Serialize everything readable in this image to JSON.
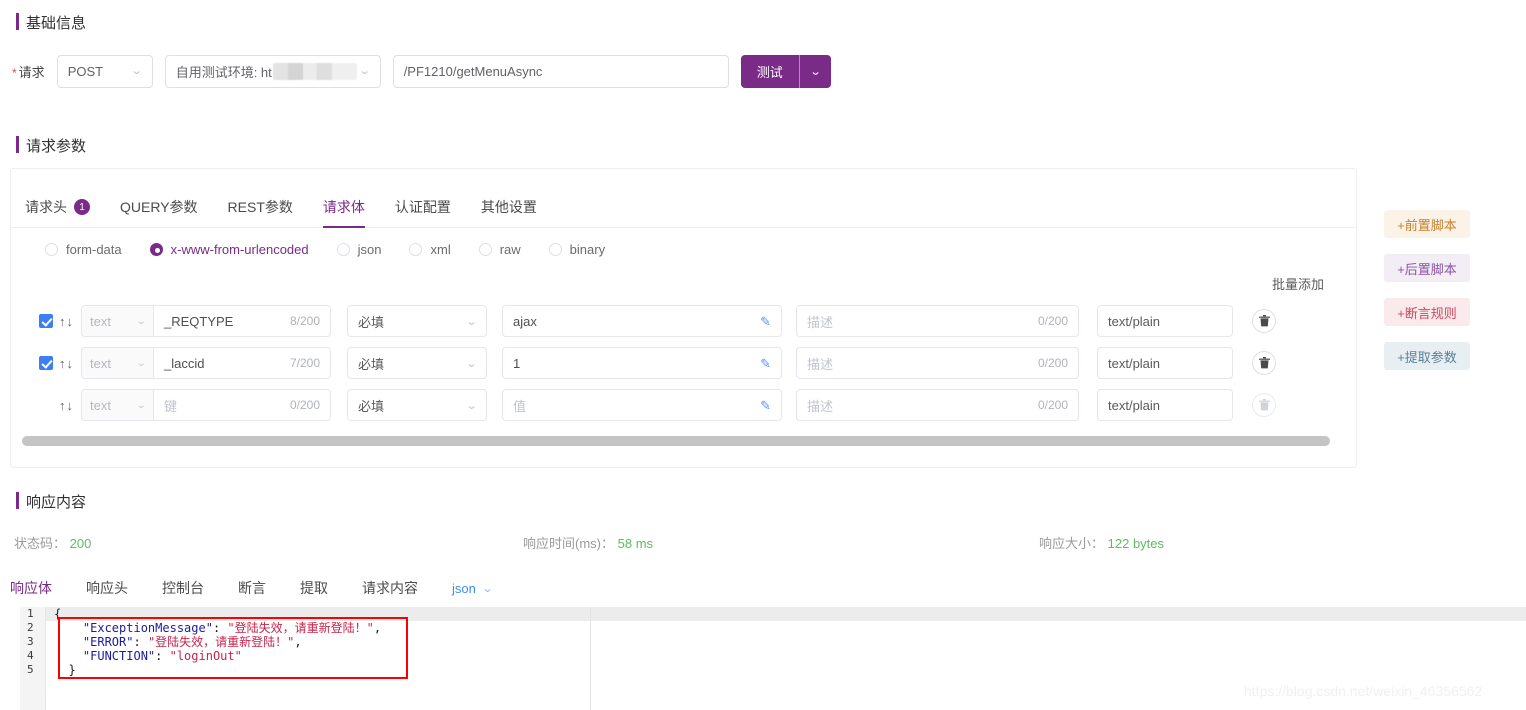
{
  "basic": {
    "section_title": "基础信息",
    "request_label": "请求",
    "required_star": "*",
    "method": "POST",
    "environment": "自用测试环境: ht",
    "url": "/PF1210/getMenuAsync",
    "test_button": "测试",
    "test_button_arrow": "⌄",
    "caret": "⌄"
  },
  "params": {
    "section_title": "请求参数",
    "tabs": [
      {
        "label": "请求头",
        "badge": "1",
        "active": false
      },
      {
        "label": "QUERY参数",
        "active": false
      },
      {
        "label": "REST参数",
        "active": false
      },
      {
        "label": "请求体",
        "active": true
      },
      {
        "label": "认证配置",
        "active": false
      },
      {
        "label": "其他设置",
        "active": false
      }
    ],
    "body_types": [
      {
        "label": "form-data",
        "checked": false
      },
      {
        "label": "x-www-from-urlencoded",
        "checked": true
      },
      {
        "label": "json",
        "checked": false
      },
      {
        "label": "xml",
        "checked": false
      },
      {
        "label": "raw",
        "checked": false
      },
      {
        "label": "binary",
        "checked": false
      }
    ],
    "batch_add": "批量添加",
    "type_label": "text",
    "key_placeholder": "键",
    "value_placeholder": "值",
    "desc_placeholder": "描述",
    "required_option": "必填",
    "up_arrow": "↑",
    "down_arrow": "↓",
    "pencil_icon": "✎",
    "trash_icon": "🗑",
    "rows": [
      {
        "checked": true,
        "type": "text",
        "key": "_REQTYPE",
        "key_count": "8/200",
        "required": "必填",
        "value": "ajax",
        "desc": "描述",
        "desc_count": "0/200",
        "content_type": "text/plain",
        "deletable": true
      },
      {
        "checked": true,
        "type": "text",
        "key": "_laccid",
        "key_count": "7/200",
        "required": "必填",
        "value": "1",
        "desc": "描述",
        "desc_count": "0/200",
        "content_type": "text/plain",
        "deletable": true
      },
      {
        "checked": false,
        "type": "text",
        "key": "键",
        "key_count": "0/200",
        "required": "必填",
        "value": "值",
        "desc": "描述",
        "desc_count": "0/200",
        "content_type": "text/plain",
        "deletable": false
      }
    ]
  },
  "side_buttons": [
    {
      "label": "+前置脚本",
      "bg": "#fcf3e8",
      "color": "#c87f2a"
    },
    {
      "label": "+后置脚本",
      "bg": "#f3edf5",
      "color": "#8b56a0"
    },
    {
      "label": "+断言规则",
      "bg": "#fbeaec",
      "color": "#cc4a60"
    },
    {
      "label": "+提取参数",
      "bg": "#e8eff2",
      "color": "#5a7f96"
    }
  ],
  "response": {
    "section_title": "响应内容",
    "status_label": "状态码：",
    "status_value": "200",
    "time_label": "响应时间(ms)：",
    "time_value": "58 ms",
    "size_label": "响应大小：",
    "size_value": "122 bytes",
    "tabs": [
      {
        "label": "响应体",
        "active": true
      },
      {
        "label": "响应头",
        "active": false
      },
      {
        "label": "控制台",
        "active": false
      },
      {
        "label": "断言",
        "active": false
      },
      {
        "label": "提取",
        "active": false
      },
      {
        "label": "请求内容",
        "active": false
      }
    ],
    "format": "json",
    "format_caret": "⌄",
    "body_lines": [
      {
        "n": "1",
        "tokens": [
          {
            "t": "p",
            "s": "{"
          }
        ]
      },
      {
        "n": "2",
        "tokens": [
          {
            "t": "p",
            "s": "    "
          },
          {
            "t": "k",
            "s": "\"ExceptionMessage\""
          },
          {
            "t": "c",
            "s": ": "
          },
          {
            "t": "s",
            "s": "\"登陆失效，请重新登陆！\""
          },
          {
            "t": "c",
            "s": ","
          }
        ]
      },
      {
        "n": "3",
        "tokens": [
          {
            "t": "p",
            "s": "    "
          },
          {
            "t": "k",
            "s": "\"ERROR\""
          },
          {
            "t": "c",
            "s": ": "
          },
          {
            "t": "s",
            "s": "\"登陆失效，请重新登陆！\""
          },
          {
            "t": "c",
            "s": ","
          }
        ]
      },
      {
        "n": "4",
        "tokens": [
          {
            "t": "p",
            "s": "    "
          },
          {
            "t": "k",
            "s": "\"FUNCTION\""
          },
          {
            "t": "c",
            "s": ": "
          },
          {
            "t": "s",
            "s": "\"loginOut\""
          }
        ]
      },
      {
        "n": "5",
        "tokens": [
          {
            "t": "p",
            "s": "  }"
          }
        ]
      }
    ]
  },
  "watermark": "https://blog.csdn.net/weixin_46356562",
  "colors": {
    "brand_purple": "#7a2a87",
    "link_blue": "#3b8ff0",
    "success_green": "#5fbb62",
    "highlight_red": "#ff0000"
  }
}
